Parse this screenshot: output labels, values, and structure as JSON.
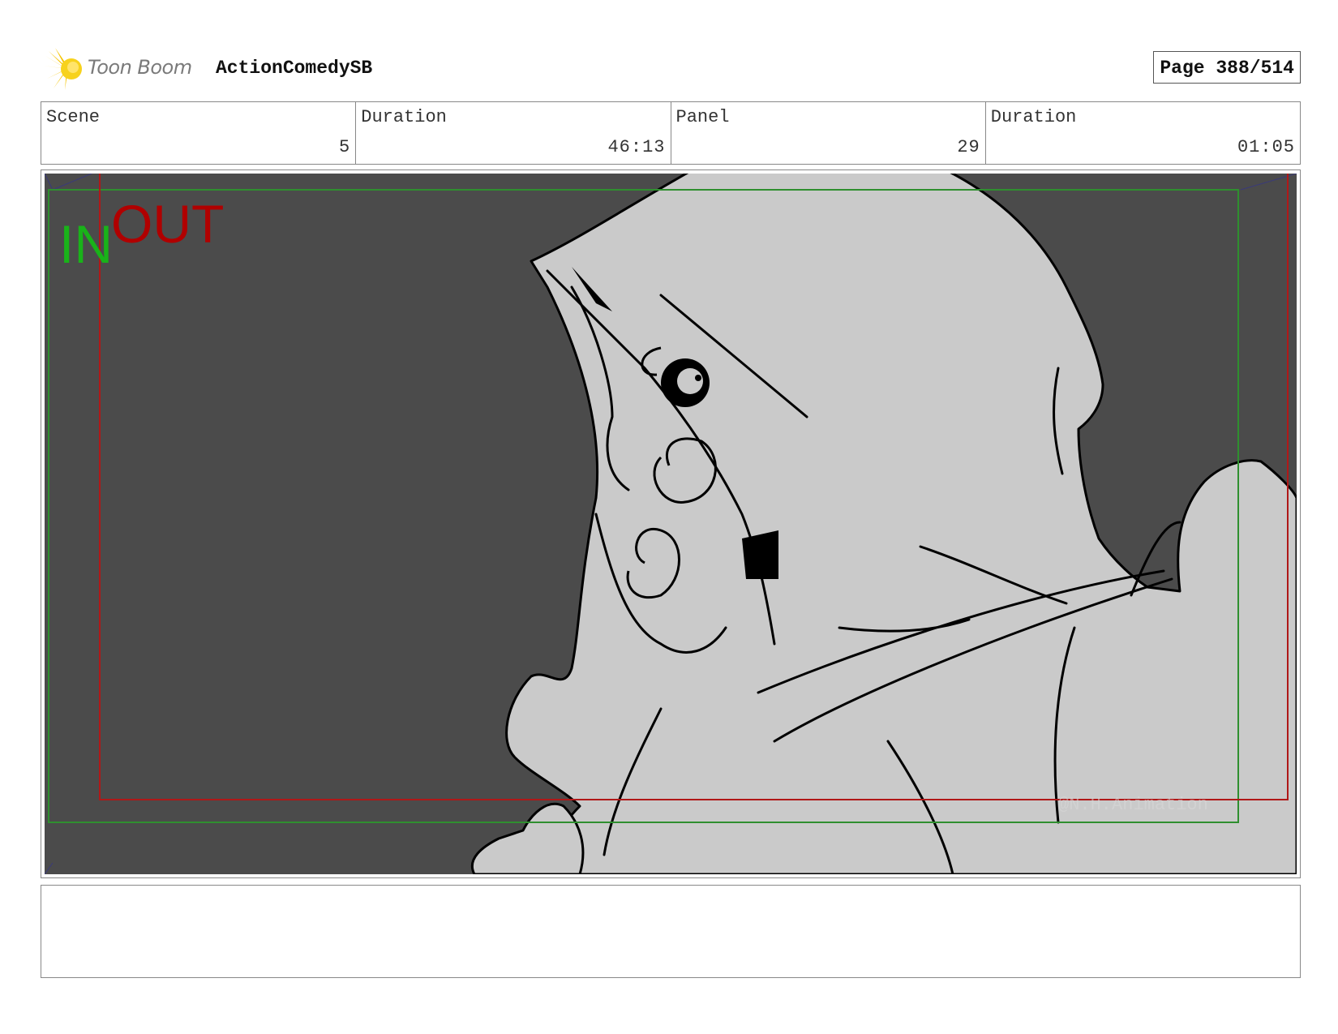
{
  "header": {
    "brand": "Toon Boom",
    "project_title": "ActionComedySB",
    "page_label": "Page 388/514"
  },
  "info": [
    {
      "label": "Scene",
      "value": "5"
    },
    {
      "label": "Duration",
      "value": "46:13"
    },
    {
      "label": "Panel",
      "value": "29"
    },
    {
      "label": "Duration",
      "value": "01:05"
    }
  ],
  "panel": {
    "in_label": "IN",
    "out_label": "OUT",
    "watermark": "@N.H.Animation"
  },
  "colors": {
    "in_frame": "#2f8f2f",
    "out_frame": "#b01818",
    "in_text": "#19b319",
    "out_text": "#b00000",
    "panel_bg": "#4b4b4b",
    "sketch_fill": "#cacaca"
  },
  "notes": {
    "text": ""
  }
}
